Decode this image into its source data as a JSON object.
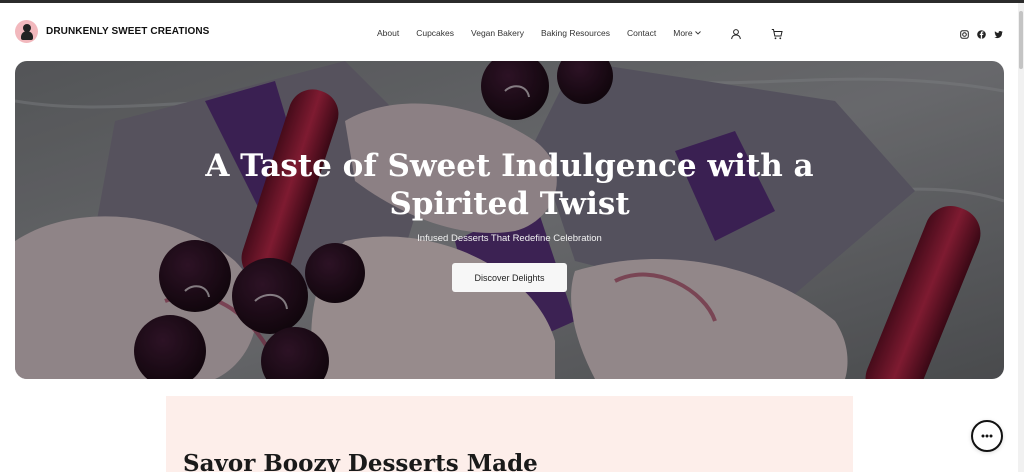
{
  "brand": {
    "name": "DRUNKENLY SWEET CREATIONS"
  },
  "nav": {
    "items": [
      "About",
      "Cupcakes",
      "Vegan Bakery",
      "Baking Resources",
      "Contact"
    ],
    "more_label": "More"
  },
  "header_icons": [
    "user-icon",
    "cart-icon"
  ],
  "social_icons": [
    "instagram-icon",
    "facebook-icon",
    "twitter-icon"
  ],
  "hero": {
    "title": "A Taste of Sweet Indulgence with a Spirited Twist",
    "subtitle": "Infused Desserts That Redefine Celebration",
    "cta_label": "Discover Delights"
  },
  "section": {
    "title": "Savor Boozy Desserts Made"
  },
  "colors": {
    "section_bg": "#fdeeea",
    "logo_bg": "#f2b8bd",
    "text_dark": "#111111"
  }
}
